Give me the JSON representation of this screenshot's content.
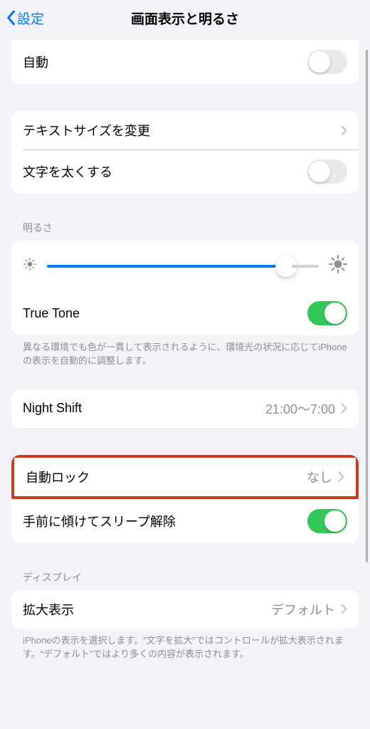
{
  "nav": {
    "back_label": "設定",
    "title": "画面表示と明るさ"
  },
  "auto_row": {
    "label": "自動",
    "on": false
  },
  "text_group": {
    "text_size": "テキストサイズを変更",
    "bold_text": "文字を太くする",
    "bold_on": false
  },
  "brightness": {
    "header": "明るさ",
    "true_tone": "True Tone",
    "true_tone_on": true,
    "footer": "異なる環境でも色が一貫して表示されるように、環境光の状況に応じてiPhoneの表示を自動的に調整します。",
    "slider_value": 88
  },
  "night_shift": {
    "label": "Night Shift",
    "value": "21:00〜7:00"
  },
  "auto_lock": {
    "label": "自動ロック",
    "value": "なし"
  },
  "raise_to_wake": {
    "label": "手前に傾けてスリープ解除",
    "on": true
  },
  "display": {
    "header": "ディスプレイ",
    "zoom_label": "拡大表示",
    "zoom_value": "デフォルト",
    "footer": "iPhoneの表示を選択します。“文字を拡大”ではコントロールが拡大表示されます。“デフォルト”ではより多くの内容が表示されます。"
  }
}
